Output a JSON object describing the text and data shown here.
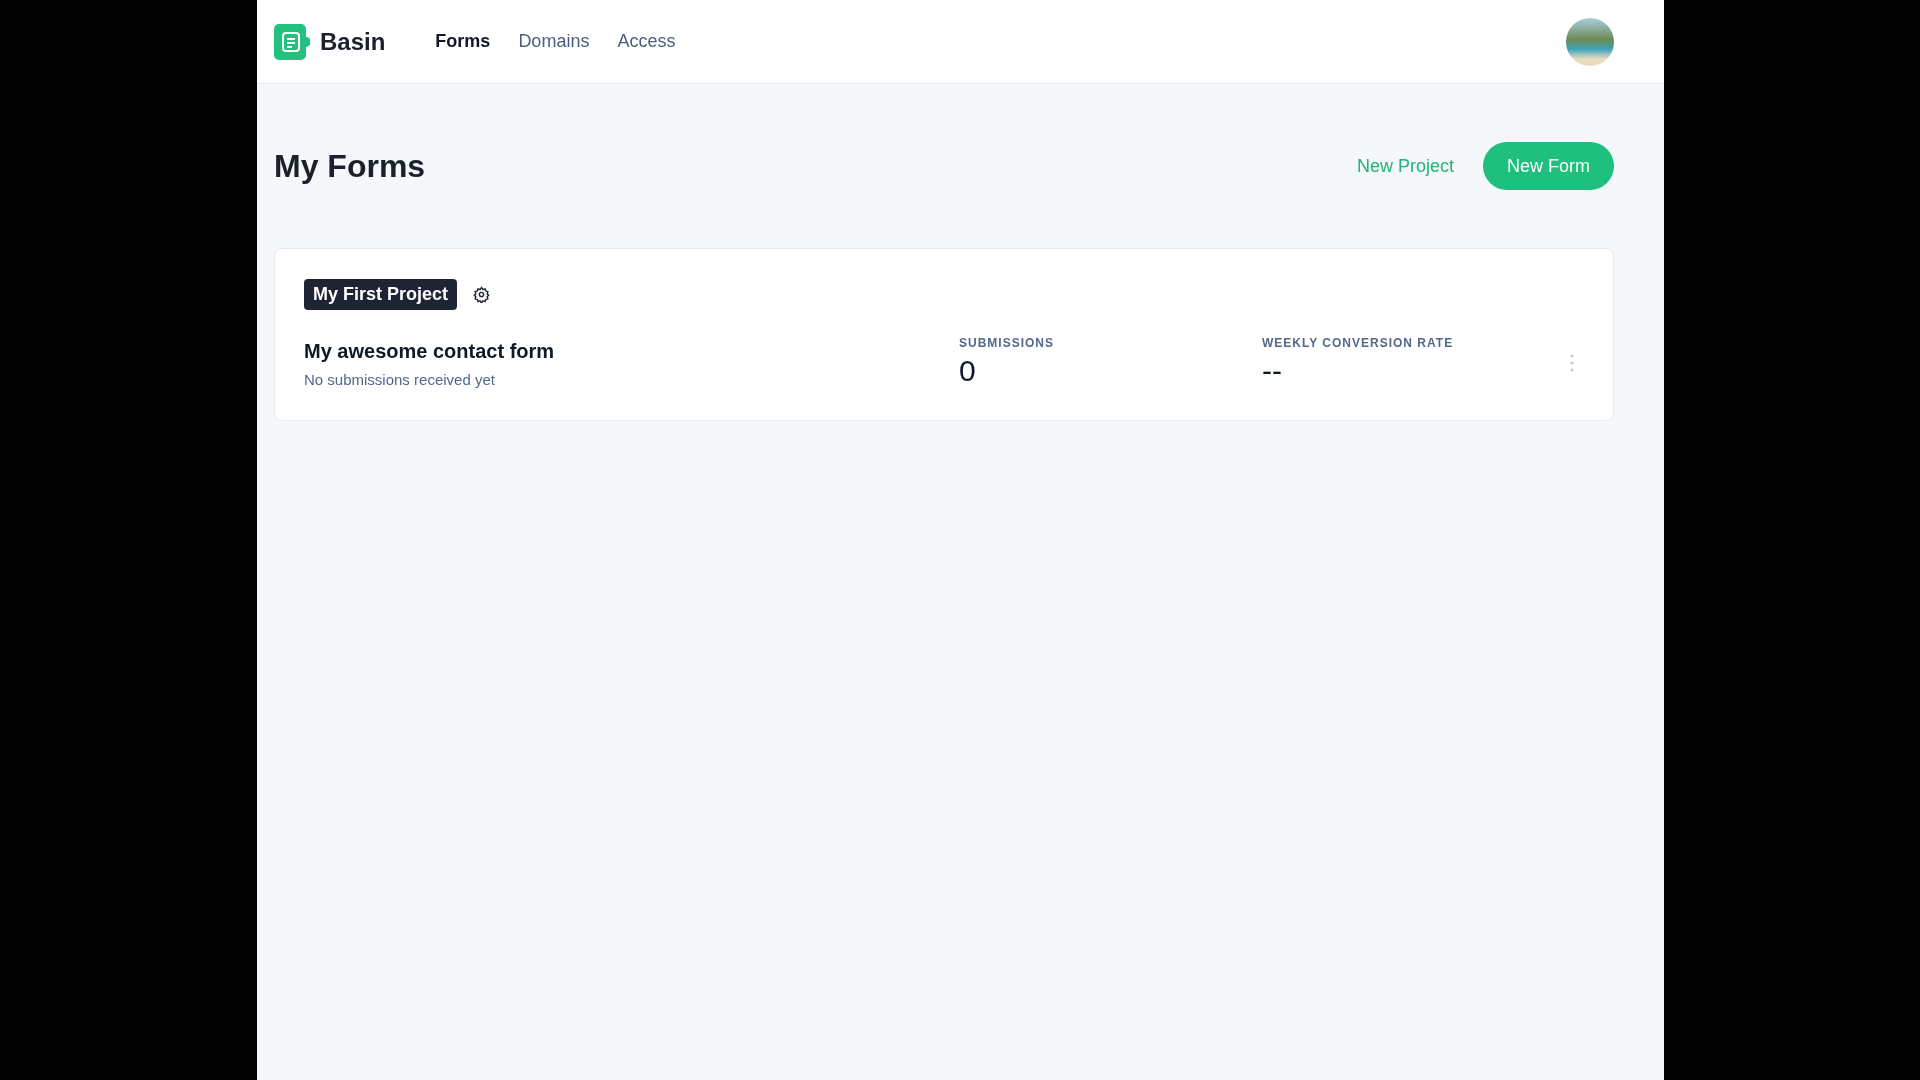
{
  "brand": {
    "name": "Basin"
  },
  "nav": [
    {
      "label": "Forms",
      "selected": true
    },
    {
      "label": "Domains",
      "selected": false
    },
    {
      "label": "Access",
      "selected": false
    }
  ],
  "page": {
    "title": "My Forms",
    "actions": [
      {
        "label": "New Project",
        "kind": "link"
      },
      {
        "label": "New Form",
        "kind": "primary"
      }
    ]
  },
  "projects": [
    {
      "name": "My First Project",
      "forms": [
        {
          "name": "My awesome contact form",
          "status": "No submissions received yet",
          "stats": [
            {
              "label": "SUBMISSIONS",
              "value": "0"
            },
            {
              "label": "WEEKLY CONVERSION RATE",
              "value": "--"
            }
          ]
        }
      ]
    }
  ]
}
